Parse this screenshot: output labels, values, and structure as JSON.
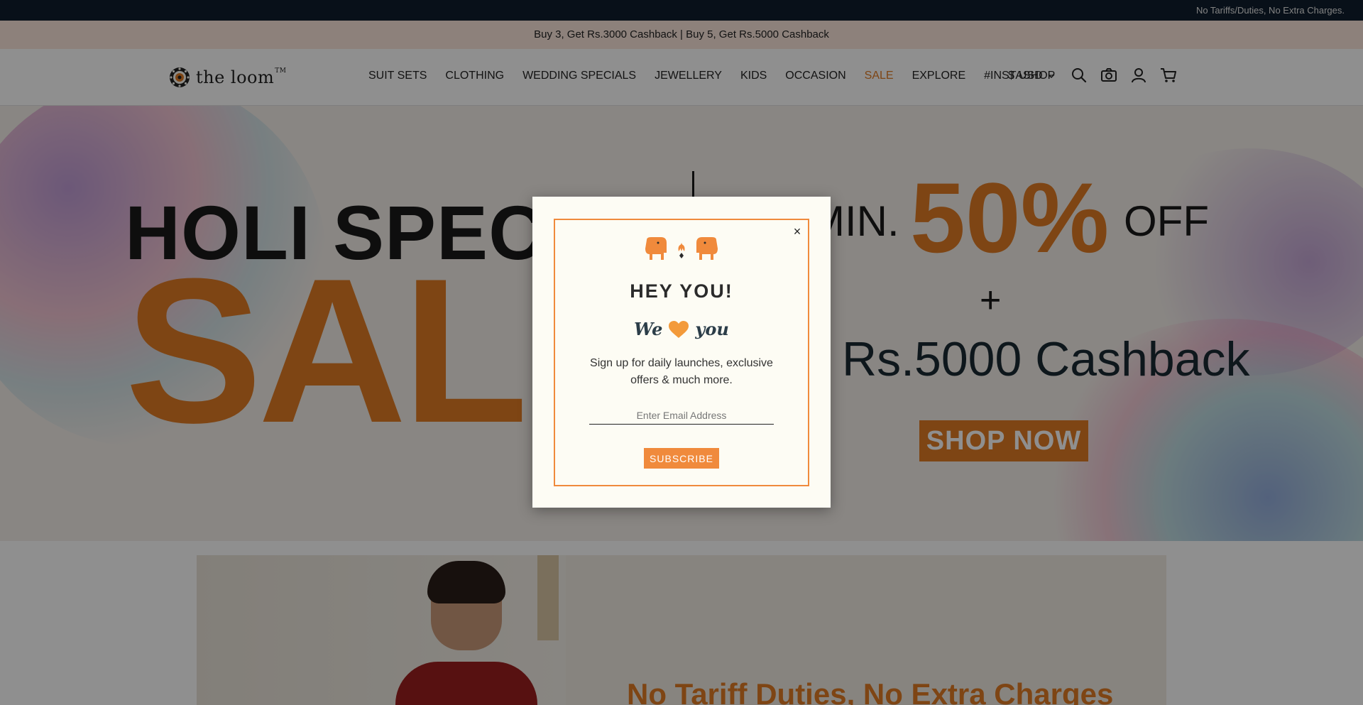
{
  "topbar": {
    "text": "No Tariffs/Duties, No Extra Charges."
  },
  "promo": {
    "text": "Buy 3, Get Rs.3000 Cashback | Buy 5, Get Rs.5000 Cashback"
  },
  "header": {
    "logo_text": "the loom",
    "logo_tm": "TM",
    "nav": [
      "SUIT SETS",
      "CLOTHING",
      "WEDDING SPECIALS",
      "JEWELLERY",
      "KIDS",
      "OCCASION",
      "SALE",
      "EXPLORE",
      "#INSTASHOP"
    ],
    "currency_symbol": "$",
    "currency_code": "USD",
    "icons": [
      "search-icon",
      "camera-icon",
      "account-icon",
      "cart-icon"
    ]
  },
  "hero": {
    "holi": "HOLI SPECIAL",
    "sale": "SALE",
    "min": "MIN.",
    "percent": "50%",
    "off": "OFF",
    "plus": "+",
    "cashback": "Rs.5000 Cashback",
    "shop_now": "SHOP NOW"
  },
  "banner2": {
    "title": "No Tariff Duties, No Extra Charges"
  },
  "modal": {
    "title": "HEY YOU!",
    "we": "We",
    "you": "you",
    "description": "Sign up for daily launches, exclusive offers & much more.",
    "email_placeholder": "Enter Email Address",
    "subscribe_label": "SUBSCRIBE",
    "close": "×"
  },
  "colors": {
    "accent": "#e07b24",
    "topbar": "#0f1e2e",
    "promo_bg": "#fbe7dc",
    "modal_border": "#f08a3c"
  }
}
